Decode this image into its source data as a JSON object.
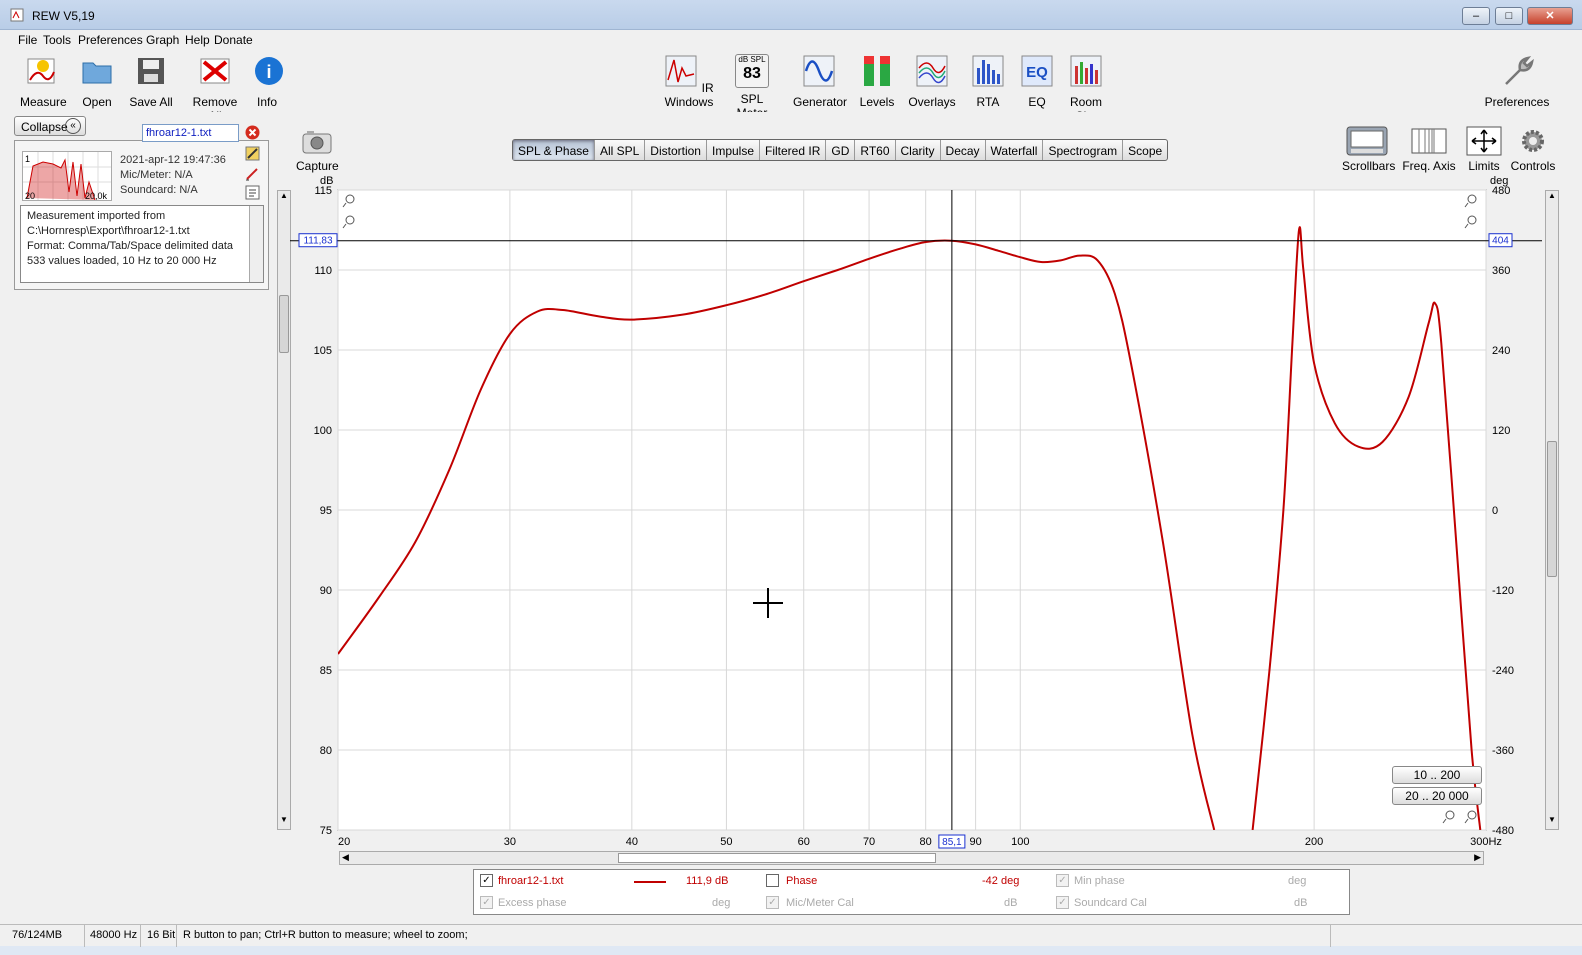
{
  "window": {
    "title": "REW V5,19"
  },
  "menu": [
    "File",
    "Tools",
    "Preferences",
    "Graph",
    "Help",
    "Donate"
  ],
  "toolbar_left": [
    {
      "label": "Measure",
      "icon": "measure-icon"
    },
    {
      "label": "Open",
      "icon": "folder-open-icon"
    },
    {
      "label": "Save All",
      "icon": "save-all-icon"
    },
    {
      "label": "Remove All",
      "icon": "remove-all-icon"
    },
    {
      "label": "Info",
      "icon": "info-icon"
    }
  ],
  "toolbar_center": [
    {
      "label": "IR Windows",
      "icon": "ir-windows-icon"
    },
    {
      "label": "SPL Meter",
      "icon": "spl-meter-icon"
    },
    {
      "label": "Generator",
      "icon": "sine-wave-icon"
    },
    {
      "label": "Levels",
      "icon": "levels-icon"
    },
    {
      "label": "Overlays",
      "icon": "overlays-icon"
    },
    {
      "label": "RTA",
      "icon": "rta-bars-icon"
    },
    {
      "label": "EQ",
      "icon": "eq-icon"
    },
    {
      "label": "Room Sim",
      "icon": "room-sim-icon"
    }
  ],
  "spl_meter_badge": {
    "top": "dB SPL",
    "value": "83"
  },
  "preferences_label": "Preferences",
  "measurement_panel": {
    "collapse_label": "Collapse",
    "name": "fhroar12-1.txt",
    "date": "2021-apr-12 19:47:36",
    "mic": "Mic/Meter: N/A",
    "soundcard": "Soundcard: N/A",
    "thumb_left": "20",
    "thumb_right": "20,0k",
    "thumb_top": "1",
    "notes": [
      "Measurement imported from",
      "C:\\Hornresp\\Export\\fhroar12-1.txt",
      "Format: Comma/Tab/Space delimited data",
      "533 values loaded, 10 Hz to 20 000 Hz"
    ]
  },
  "capture_label": "Capture",
  "graph_tabs": [
    "SPL & Phase",
    "All SPL",
    "Distortion",
    "Impulse",
    "Filtered IR",
    "GD",
    "RT60",
    "Clarity",
    "Decay",
    "Waterfall",
    "Spectrogram",
    "Scope"
  ],
  "active_tab": "SPL & Phase",
  "right_tools": [
    {
      "label": "Scrollbars",
      "icon": "scrollbars-icon"
    },
    {
      "label": "Freq. Axis",
      "icon": "freq-axis-icon"
    },
    {
      "label": "Limits",
      "icon": "limits-arrows-icon"
    },
    {
      "label": "Controls",
      "icon": "gear-icon"
    }
  ],
  "range_buttons": [
    "10 .. 200",
    "20 .. 20 000"
  ],
  "chart_data": {
    "type": "line",
    "x_scale": "log",
    "xlim": [
      20,
      300
    ],
    "ylim": [
      75,
      115
    ],
    "y2lim": [
      -480,
      480
    ],
    "ylabel": "dB",
    "y2label": "deg",
    "x_ticks": [
      20,
      30,
      40,
      50,
      60,
      70,
      80,
      90,
      100,
      200,
      300
    ],
    "x_tick_labels": [
      "20",
      "30",
      "40",
      "50",
      "60",
      "70",
      "80",
      "90",
      "100",
      "200",
      "300Hz"
    ],
    "y_ticks": [
      75,
      80,
      85,
      90,
      95,
      100,
      105,
      110,
      115
    ],
    "y2_ticks": [
      -480,
      -360,
      -240,
      -120,
      0,
      120,
      240,
      360,
      480
    ],
    "cursor": {
      "x": 85.1,
      "x_label": "85,1",
      "y": 111.83,
      "y_label": "111,83",
      "y2_label": "404"
    },
    "grid": true,
    "series": [
      {
        "name": "fhroar12-1.txt",
        "color": "#c00000",
        "points": [
          [
            20,
            86.0
          ],
          [
            22,
            89.5
          ],
          [
            24,
            93.0
          ],
          [
            26,
            97.5
          ],
          [
            28,
            102.5
          ],
          [
            30,
            106.0
          ],
          [
            32,
            107.4
          ],
          [
            34,
            107.5
          ],
          [
            37,
            107.1
          ],
          [
            40,
            106.9
          ],
          [
            45,
            107.2
          ],
          [
            50,
            107.8
          ],
          [
            55,
            108.5
          ],
          [
            60,
            109.3
          ],
          [
            65,
            110.0
          ],
          [
            70,
            110.7
          ],
          [
            75,
            111.3
          ],
          [
            80,
            111.75
          ],
          [
            85,
            111.83
          ],
          [
            90,
            111.6
          ],
          [
            95,
            111.2
          ],
          [
            100,
            110.8
          ],
          [
            105,
            110.5
          ],
          [
            110,
            110.6
          ],
          [
            115,
            110.9
          ],
          [
            120,
            110.6
          ],
          [
            125,
            108.5
          ],
          [
            130,
            104.0
          ],
          [
            140,
            93.0
          ],
          [
            150,
            81.0
          ],
          [
            158,
            75.0
          ]
        ]
      },
      {
        "name": "fhroar12-1.txt phase",
        "color": "#c00000",
        "axis": "y2",
        "points": [
          [
            173,
            -480
          ],
          [
            180,
            -240
          ],
          [
            186,
            0
          ],
          [
            190,
            250
          ],
          [
            193,
            420
          ],
          [
            195,
            360
          ],
          [
            200,
            220
          ],
          [
            210,
            130
          ],
          [
            222,
            95
          ],
          [
            235,
            102
          ],
          [
            250,
            170
          ],
          [
            262,
            280
          ],
          [
            266,
            310
          ],
          [
            270,
            250
          ],
          [
            280,
            -60
          ],
          [
            290,
            -360
          ],
          [
            296,
            -480
          ]
        ]
      }
    ]
  },
  "legend": {
    "row1": [
      {
        "label": "fhroar12-1.txt",
        "value": "111,9 dB",
        "checked": true,
        "active": true
      },
      {
        "label": "Phase",
        "value": "-42 deg",
        "checked": false,
        "active": true
      },
      {
        "label": "Min phase",
        "value": "deg",
        "checked": true,
        "active": false
      }
    ],
    "row2": [
      {
        "label": "Excess phase",
        "value": "deg",
        "checked": true,
        "active": false
      },
      {
        "label": "Mic/Meter Cal",
        "value": "dB",
        "checked": true,
        "active": false
      },
      {
        "label": "Soundcard Cal",
        "value": "dB",
        "checked": true,
        "active": false
      }
    ]
  },
  "status": {
    "memory": "76/124MB",
    "rate": "48000 Hz",
    "bits": "16 Bit",
    "hint": "R button to pan; Ctrl+R button to measure; wheel to zoom;"
  }
}
